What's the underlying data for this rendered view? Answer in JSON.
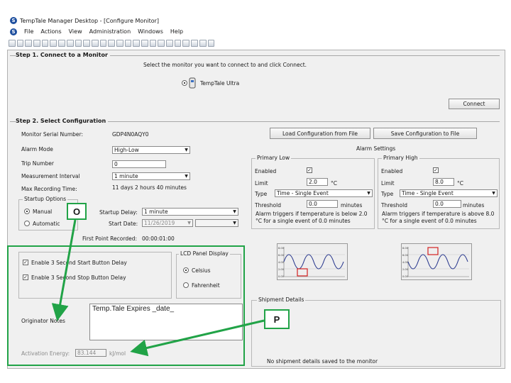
{
  "window": {
    "title": "TempTale Manager Desktop - [Configure Monitor]"
  },
  "menu": {
    "items": [
      "File",
      "Actions",
      "View",
      "Administration",
      "Windows",
      "Help"
    ]
  },
  "toolbar": {
    "icon_count": 25
  },
  "step1": {
    "heading": "Step 1. Connect to a Monitor",
    "instruction": "Select the monitor you want to connect to and click Connect.",
    "device_label": "TempTale Ultra",
    "connect_label": "Connect"
  },
  "step2": {
    "heading": "Step 2. Select Configuration",
    "serial_label": "Monitor Serial Number:",
    "serial_value": "GDP4N0AQY0",
    "load_label": "Load Configuration from File",
    "save_label": "Save Configuration to File",
    "alarm_mode_label": "Alarm Mode",
    "alarm_mode_value": "High-Low",
    "trip_label": "Trip Number",
    "trip_value": "0",
    "interval_label": "Measurement Interval",
    "interval_value": "1 minute",
    "max_rec_label": "Max Recording Time:",
    "max_rec_value": "11 days 2 hours 40 minutes",
    "startup_title": "Startup Options",
    "manual_label": "Manual",
    "automatic_label": "Automatic",
    "startup_delay_label": "Startup Delay:",
    "startup_delay_value": "1 minute",
    "start_date_label": "Start Date:",
    "start_date_value": "11/26/2019",
    "first_point_label": "First Point Recorded:",
    "first_point_value": "00:00:01:00",
    "enable_start_label": "Enable 3 Second Start Button Delay",
    "enable_stop_label": "Enable 3 Second Stop Button Delay",
    "lcd_title": "LCD Panel Display",
    "celsius_label": "Celsius",
    "fahrenheit_label": "Fahrenheit",
    "notes_label": "Originator Notes",
    "notes_value": "Temp.Tale Expires _date_",
    "activation_label": "Activation Energy:",
    "activation_value": "83.144",
    "activation_unit": "kJ/mol"
  },
  "alarm": {
    "title": "Alarm Settings",
    "low": {
      "title": "Primary Low",
      "enabled_label": "Enabled",
      "limit_label": "Limit",
      "limit_value": "2.0",
      "limit_unit": "°C",
      "type_label": "Type",
      "type_value": "Time - Single Event",
      "threshold_label": "Threshold",
      "threshold_value": "0.0",
      "threshold_unit": "minutes",
      "note": "Alarm triggers if temperature is below 2.0 °C for a single event of 0.0 minutes"
    },
    "high": {
      "title": "Primary High",
      "enabled_label": "Enabled",
      "limit_label": "Limit",
      "limit_value": "8.0",
      "limit_unit": "°C",
      "type_label": "Type",
      "type_value": "Time - Single Event",
      "threshold_label": "Threshold",
      "threshold_value": "0.0",
      "threshold_unit": "minutes",
      "note": "Alarm triggers if temperature is above 8.0 °C for a single event of 0.0 minutes"
    }
  },
  "shipment": {
    "title": "Shipment Details",
    "empty_text": "No shipment details saved to the monitor"
  },
  "callouts": {
    "o": "O",
    "p": "P"
  },
  "colors": {
    "highlight": "#21a347",
    "alarm_mark": "#d42020",
    "wave": "#2b3a8f"
  }
}
